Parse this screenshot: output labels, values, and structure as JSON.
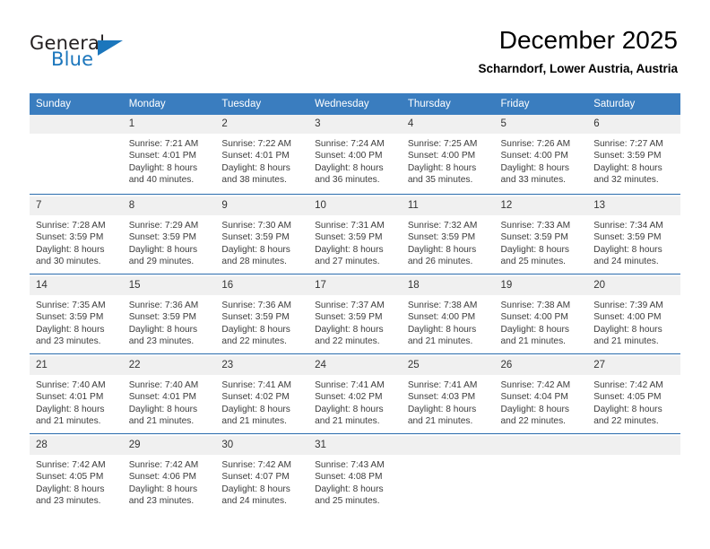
{
  "brand": {
    "name_top": "General",
    "name_bottom": "Blue",
    "accent_color": "#1b76bc",
    "logo_icon": "triangle-flag-icon"
  },
  "header": {
    "title": "December 2025",
    "subtitle": "Scharndorf, Lower Austria, Austria"
  },
  "theme": {
    "header_row_bg": "#3a7dbf",
    "week_separator": "#2b6cad",
    "daynum_band_bg": "#f0f0f0",
    "cell_bg": "#ffffff"
  },
  "weekdays": [
    "Sunday",
    "Monday",
    "Tuesday",
    "Wednesday",
    "Thursday",
    "Friday",
    "Saturday"
  ],
  "weeks": [
    [
      {
        "day": "",
        "sunrise": "",
        "sunset": "",
        "daylight1": "",
        "daylight2": ""
      },
      {
        "day": "1",
        "sunrise": "Sunrise: 7:21 AM",
        "sunset": "Sunset: 4:01 PM",
        "daylight1": "Daylight: 8 hours",
        "daylight2": "and 40 minutes."
      },
      {
        "day": "2",
        "sunrise": "Sunrise: 7:22 AM",
        "sunset": "Sunset: 4:01 PM",
        "daylight1": "Daylight: 8 hours",
        "daylight2": "and 38 minutes."
      },
      {
        "day": "3",
        "sunrise": "Sunrise: 7:24 AM",
        "sunset": "Sunset: 4:00 PM",
        "daylight1": "Daylight: 8 hours",
        "daylight2": "and 36 minutes."
      },
      {
        "day": "4",
        "sunrise": "Sunrise: 7:25 AM",
        "sunset": "Sunset: 4:00 PM",
        "daylight1": "Daylight: 8 hours",
        "daylight2": "and 35 minutes."
      },
      {
        "day": "5",
        "sunrise": "Sunrise: 7:26 AM",
        "sunset": "Sunset: 4:00 PM",
        "daylight1": "Daylight: 8 hours",
        "daylight2": "and 33 minutes."
      },
      {
        "day": "6",
        "sunrise": "Sunrise: 7:27 AM",
        "sunset": "Sunset: 3:59 PM",
        "daylight1": "Daylight: 8 hours",
        "daylight2": "and 32 minutes."
      }
    ],
    [
      {
        "day": "7",
        "sunrise": "Sunrise: 7:28 AM",
        "sunset": "Sunset: 3:59 PM",
        "daylight1": "Daylight: 8 hours",
        "daylight2": "and 30 minutes."
      },
      {
        "day": "8",
        "sunrise": "Sunrise: 7:29 AM",
        "sunset": "Sunset: 3:59 PM",
        "daylight1": "Daylight: 8 hours",
        "daylight2": "and 29 minutes."
      },
      {
        "day": "9",
        "sunrise": "Sunrise: 7:30 AM",
        "sunset": "Sunset: 3:59 PM",
        "daylight1": "Daylight: 8 hours",
        "daylight2": "and 28 minutes."
      },
      {
        "day": "10",
        "sunrise": "Sunrise: 7:31 AM",
        "sunset": "Sunset: 3:59 PM",
        "daylight1": "Daylight: 8 hours",
        "daylight2": "and 27 minutes."
      },
      {
        "day": "11",
        "sunrise": "Sunrise: 7:32 AM",
        "sunset": "Sunset: 3:59 PM",
        "daylight1": "Daylight: 8 hours",
        "daylight2": "and 26 minutes."
      },
      {
        "day": "12",
        "sunrise": "Sunrise: 7:33 AM",
        "sunset": "Sunset: 3:59 PM",
        "daylight1": "Daylight: 8 hours",
        "daylight2": "and 25 minutes."
      },
      {
        "day": "13",
        "sunrise": "Sunrise: 7:34 AM",
        "sunset": "Sunset: 3:59 PM",
        "daylight1": "Daylight: 8 hours",
        "daylight2": "and 24 minutes."
      }
    ],
    [
      {
        "day": "14",
        "sunrise": "Sunrise: 7:35 AM",
        "sunset": "Sunset: 3:59 PM",
        "daylight1": "Daylight: 8 hours",
        "daylight2": "and 23 minutes."
      },
      {
        "day": "15",
        "sunrise": "Sunrise: 7:36 AM",
        "sunset": "Sunset: 3:59 PM",
        "daylight1": "Daylight: 8 hours",
        "daylight2": "and 23 minutes."
      },
      {
        "day": "16",
        "sunrise": "Sunrise: 7:36 AM",
        "sunset": "Sunset: 3:59 PM",
        "daylight1": "Daylight: 8 hours",
        "daylight2": "and 22 minutes."
      },
      {
        "day": "17",
        "sunrise": "Sunrise: 7:37 AM",
        "sunset": "Sunset: 3:59 PM",
        "daylight1": "Daylight: 8 hours",
        "daylight2": "and 22 minutes."
      },
      {
        "day": "18",
        "sunrise": "Sunrise: 7:38 AM",
        "sunset": "Sunset: 4:00 PM",
        "daylight1": "Daylight: 8 hours",
        "daylight2": "and 21 minutes."
      },
      {
        "day": "19",
        "sunrise": "Sunrise: 7:38 AM",
        "sunset": "Sunset: 4:00 PM",
        "daylight1": "Daylight: 8 hours",
        "daylight2": "and 21 minutes."
      },
      {
        "day": "20",
        "sunrise": "Sunrise: 7:39 AM",
        "sunset": "Sunset: 4:00 PM",
        "daylight1": "Daylight: 8 hours",
        "daylight2": "and 21 minutes."
      }
    ],
    [
      {
        "day": "21",
        "sunrise": "Sunrise: 7:40 AM",
        "sunset": "Sunset: 4:01 PM",
        "daylight1": "Daylight: 8 hours",
        "daylight2": "and 21 minutes."
      },
      {
        "day": "22",
        "sunrise": "Sunrise: 7:40 AM",
        "sunset": "Sunset: 4:01 PM",
        "daylight1": "Daylight: 8 hours",
        "daylight2": "and 21 minutes."
      },
      {
        "day": "23",
        "sunrise": "Sunrise: 7:41 AM",
        "sunset": "Sunset: 4:02 PM",
        "daylight1": "Daylight: 8 hours",
        "daylight2": "and 21 minutes."
      },
      {
        "day": "24",
        "sunrise": "Sunrise: 7:41 AM",
        "sunset": "Sunset: 4:02 PM",
        "daylight1": "Daylight: 8 hours",
        "daylight2": "and 21 minutes."
      },
      {
        "day": "25",
        "sunrise": "Sunrise: 7:41 AM",
        "sunset": "Sunset: 4:03 PM",
        "daylight1": "Daylight: 8 hours",
        "daylight2": "and 21 minutes."
      },
      {
        "day": "26",
        "sunrise": "Sunrise: 7:42 AM",
        "sunset": "Sunset: 4:04 PM",
        "daylight1": "Daylight: 8 hours",
        "daylight2": "and 22 minutes."
      },
      {
        "day": "27",
        "sunrise": "Sunrise: 7:42 AM",
        "sunset": "Sunset: 4:05 PM",
        "daylight1": "Daylight: 8 hours",
        "daylight2": "and 22 minutes."
      }
    ],
    [
      {
        "day": "28",
        "sunrise": "Sunrise: 7:42 AM",
        "sunset": "Sunset: 4:05 PM",
        "daylight1": "Daylight: 8 hours",
        "daylight2": "and 23 minutes."
      },
      {
        "day": "29",
        "sunrise": "Sunrise: 7:42 AM",
        "sunset": "Sunset: 4:06 PM",
        "daylight1": "Daylight: 8 hours",
        "daylight2": "and 23 minutes."
      },
      {
        "day": "30",
        "sunrise": "Sunrise: 7:42 AM",
        "sunset": "Sunset: 4:07 PM",
        "daylight1": "Daylight: 8 hours",
        "daylight2": "and 24 minutes."
      },
      {
        "day": "31",
        "sunrise": "Sunrise: 7:43 AM",
        "sunset": "Sunset: 4:08 PM",
        "daylight1": "Daylight: 8 hours",
        "daylight2": "and 25 minutes."
      },
      {
        "day": "",
        "sunrise": "",
        "sunset": "",
        "daylight1": "",
        "daylight2": ""
      },
      {
        "day": "",
        "sunrise": "",
        "sunset": "",
        "daylight1": "",
        "daylight2": ""
      },
      {
        "day": "",
        "sunrise": "",
        "sunset": "",
        "daylight1": "",
        "daylight2": ""
      }
    ]
  ]
}
